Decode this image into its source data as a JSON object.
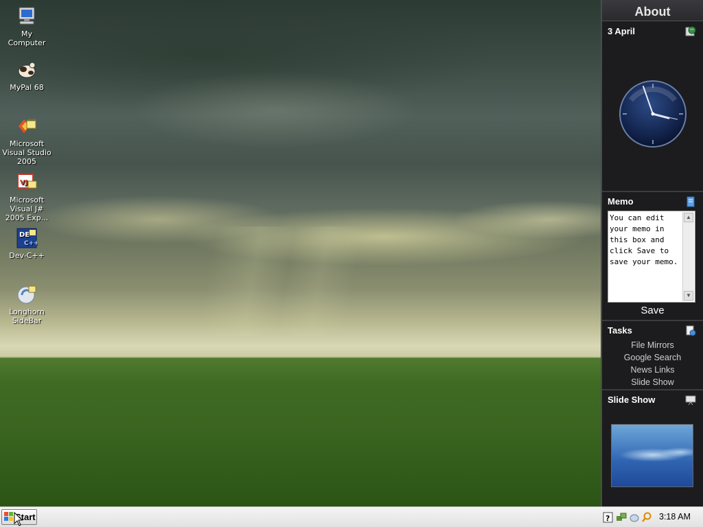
{
  "desktop": {
    "icons": [
      {
        "label": "My Computer",
        "icon": "computer-icon"
      },
      {
        "label": "MyPal 68",
        "icon": "mypal-browser-icon"
      },
      {
        "label": "Microsoft Visual Studio 2005",
        "icon": "visual-studio-icon"
      },
      {
        "label": "Microsoft Visual J# 2005 Exp...",
        "icon": "visual-jsharp-icon"
      },
      {
        "label": "Dev-C++",
        "icon": "dev-cpp-icon"
      },
      {
        "label": "Longhorn SideBar",
        "icon": "longhorn-sidebar-icon"
      }
    ]
  },
  "sidebar": {
    "header": "About",
    "clock_tile": {
      "title": "3 April",
      "icon": "globe-icon",
      "time_shown": "3:18"
    },
    "memo_tile": {
      "title": "Memo",
      "icon": "notepad-icon",
      "text": "You can edit your memo in this box and click Save to save your memo.",
      "save_label": "Save"
    },
    "tasks_tile": {
      "title": "Tasks",
      "icon": "tasks-icon",
      "links": [
        "File Mirrors",
        "Google Search",
        "News Links",
        "Slide Show"
      ]
    },
    "slideshow_tile": {
      "title": "Slide Show",
      "icon": "slideshow-icon"
    }
  },
  "taskbar": {
    "start_label": "Start",
    "tray_icons": [
      "help-icon",
      "network-icon",
      "volume-icon",
      "search-icon"
    ],
    "clock": "3:18 AM"
  },
  "colors": {
    "sidebar_bg": "#1c1c1e",
    "taskbar_bg": "#e8e8e8",
    "accent_blue": "#1f4a98"
  }
}
